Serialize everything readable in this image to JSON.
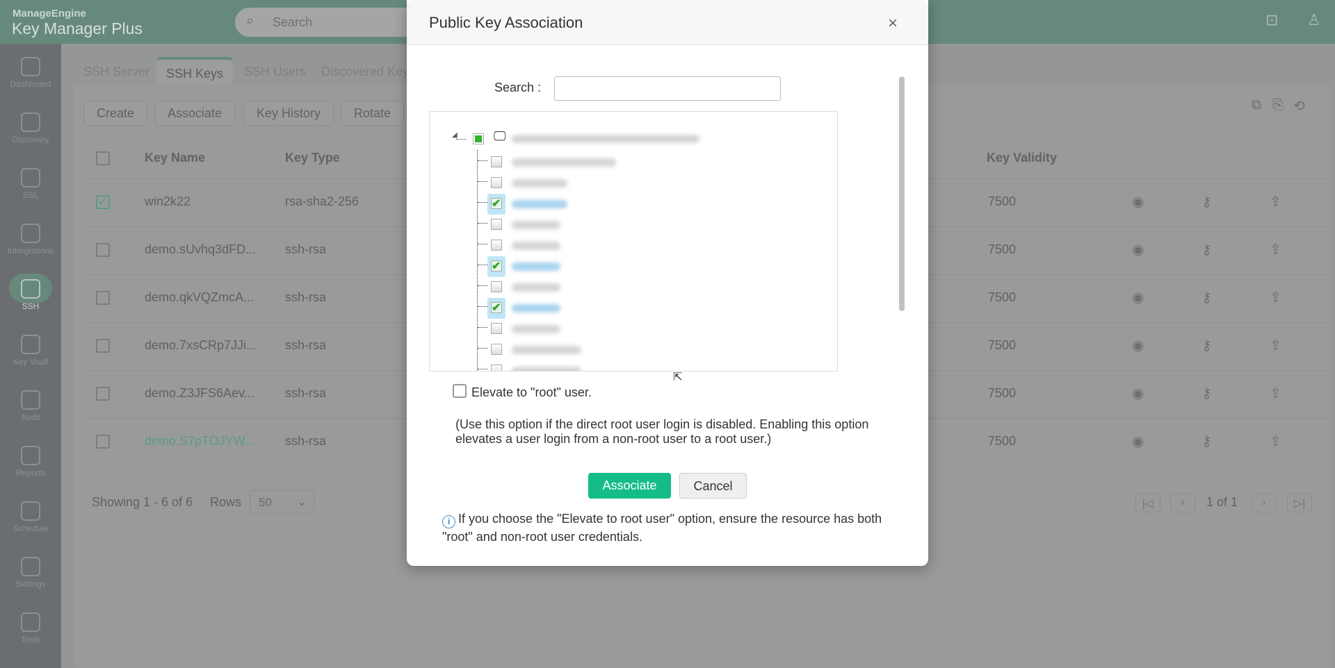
{
  "app": {
    "vendor": "ManageEngine",
    "product": "Key Manager Plus",
    "search_placeholder": "Search"
  },
  "sidebar": {
    "items": [
      {
        "label": "Dashboard",
        "icon": "dashboard-icon"
      },
      {
        "label": "Discovery",
        "icon": "compass-icon"
      },
      {
        "label": "SSL",
        "icon": "certificate-icon"
      },
      {
        "label": "Intergrations",
        "icon": "plug-icon"
      },
      {
        "label": "SSH",
        "icon": "terminal-icon",
        "active": true
      },
      {
        "label": "Key Vault",
        "icon": "vault-icon"
      },
      {
        "label": "Audit",
        "icon": "audit-icon"
      },
      {
        "label": "Reports",
        "icon": "reports-icon"
      },
      {
        "label": "Schedule",
        "icon": "calendar-icon"
      },
      {
        "label": "Settings",
        "icon": "gear-icon"
      },
      {
        "label": "Tools",
        "icon": "tools-icon"
      }
    ]
  },
  "tabs": [
    "SSH Server",
    "SSH Keys",
    "SSH Users",
    "Discovered Keys"
  ],
  "toolbar": [
    "Create",
    "Associate",
    "Key History",
    "Rotate"
  ],
  "table": {
    "headers": {
      "name": "Key Name",
      "type": "Key Type",
      "validity": "Key Validity"
    },
    "rows": [
      {
        "name": "win2k22",
        "type": "rsa-sha2-256",
        "validity": "7500",
        "checked": true
      },
      {
        "name": "demo.sUvhq3dFD...",
        "type": "ssh-rsa",
        "validity": "7500"
      },
      {
        "name": "demo.qkVQZmcA...",
        "type": "ssh-rsa",
        "validity": "7500"
      },
      {
        "name": "demo.7xsCRp7JJi...",
        "type": "ssh-rsa",
        "validity": "7500"
      },
      {
        "name": "demo.Z3JFS6Aev...",
        "type": "ssh-rsa",
        "validity": "7500"
      },
      {
        "name": "demo.S7pTOJYW...",
        "type": "ssh-rsa",
        "validity": "7500",
        "link": true
      }
    ]
  },
  "footer": {
    "showing": "Showing 1 - 6 of 6",
    "rows_label": "Rows",
    "rows_value": "50",
    "page": "1 of 1"
  },
  "dialog": {
    "title": "Public Key Association",
    "search_label": "Search :",
    "search_value": "",
    "tree_children_checked": [
      false,
      false,
      true,
      false,
      false,
      true,
      false,
      true,
      false,
      false,
      false
    ],
    "elevate_label": "Elevate to \"root\" user.",
    "elevate_checked": false,
    "note": "(Use this option if the direct root user login is disabled. Enabling this option elevates a user login from a non-root user to a root user.)",
    "associate": "Associate",
    "cancel": "Cancel",
    "info": "If you choose the \"Elevate to root user\" option, ensure the resource has both \"root\" and non-root user credentials."
  },
  "colors": {
    "accent": "#14bd87",
    "header": "#67897c"
  }
}
